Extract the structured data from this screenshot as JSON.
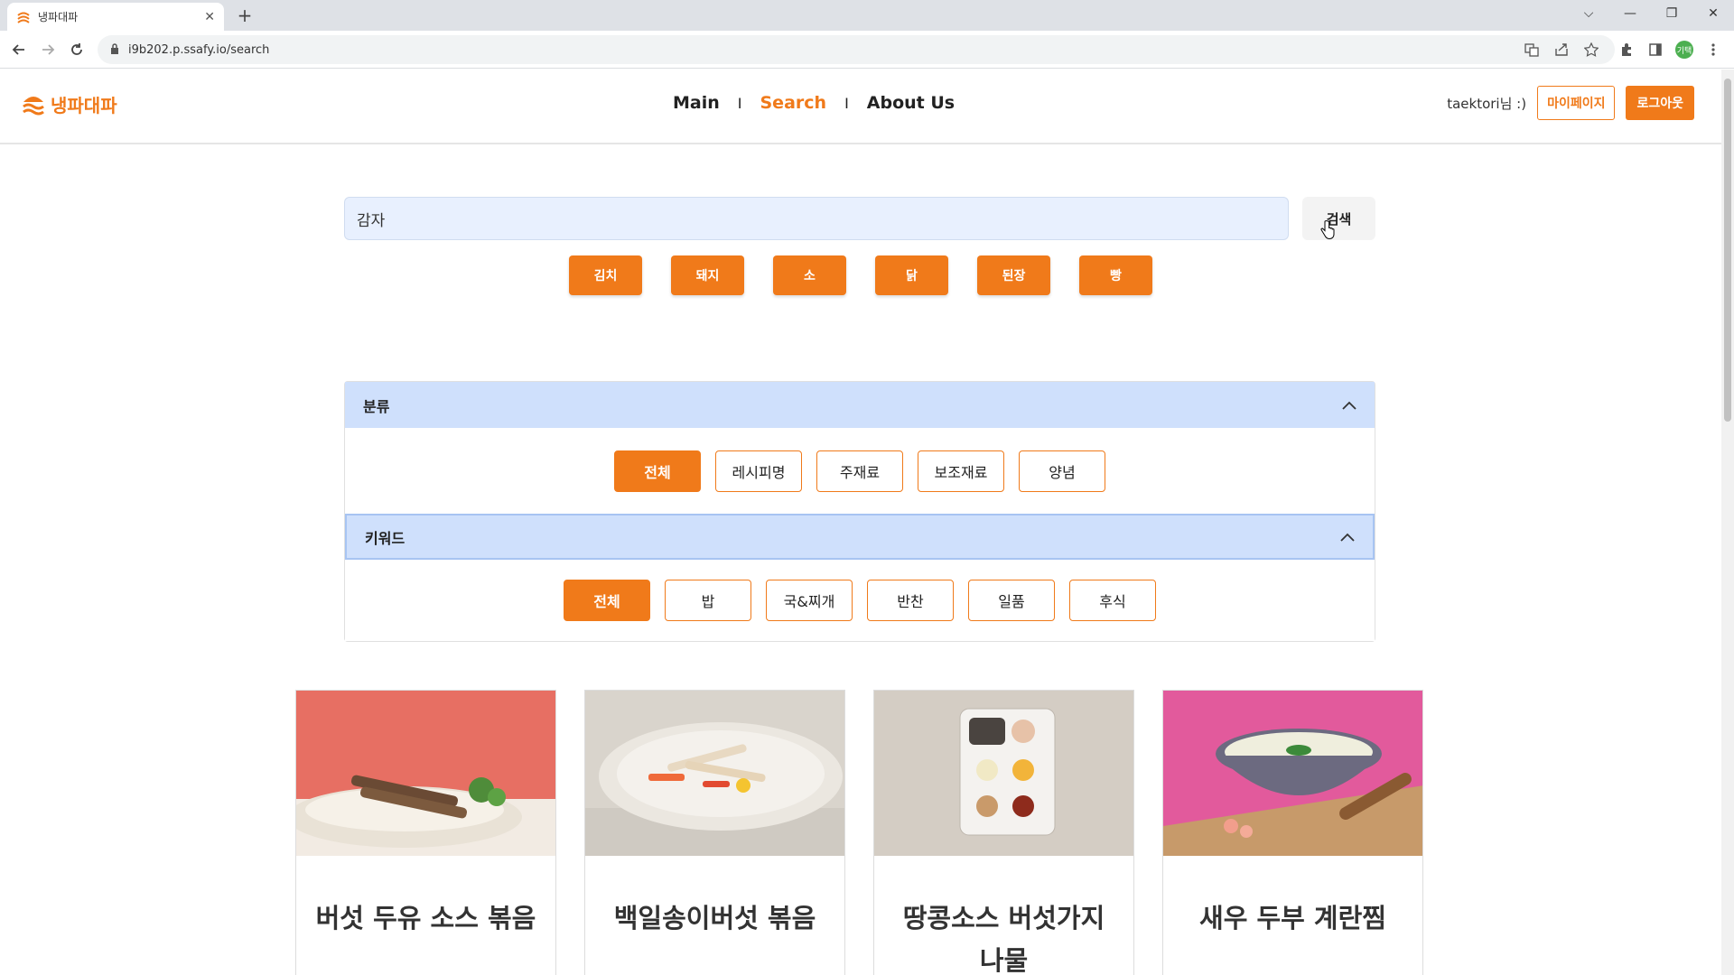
{
  "browser": {
    "tab_title": "냉파대파",
    "tab_close": "✕",
    "new_tab": "+",
    "url": "i9b202.p.ssafy.io/search",
    "profile_initials": "기택",
    "window_controls": {
      "dropdown": "⌵",
      "minimize": "—",
      "restore": "❐",
      "close": "✕"
    }
  },
  "header": {
    "logo_text": "냉파대파",
    "nav": [
      {
        "label": "Main",
        "active": false
      },
      {
        "label": "Search",
        "active": true
      },
      {
        "label": "About Us",
        "active": false
      }
    ],
    "nav_separator": "I",
    "user_greeting": "taektori님 :)",
    "mypage_label": "마이페이지",
    "logout_label": "로그아웃"
  },
  "search": {
    "value": "감자",
    "button_label": "검색",
    "quick_chips": [
      "김치",
      "돼지",
      "소",
      "닭",
      "된장",
      "빵"
    ]
  },
  "filters": {
    "category": {
      "title": "분류",
      "options": [
        "전체",
        "레시피명",
        "주재료",
        "보조재료",
        "양념"
      ],
      "selected": "전체"
    },
    "keyword": {
      "title": "키워드",
      "options": [
        "전체",
        "밥",
        "국&찌개",
        "반찬",
        "일품",
        "후식"
      ],
      "selected": "전체"
    }
  },
  "recipes": [
    {
      "name": "버섯 두유 소스 볶음"
    },
    {
      "name": "백일송이버섯 볶음"
    },
    {
      "name": "땅콩소스 버섯가지나물"
    },
    {
      "name": "새우 두부 계란찜"
    }
  ],
  "colors": {
    "accent": "#f07a1a",
    "accordion_head": "#cfe0fc",
    "search_bg": "#e8f0fe"
  }
}
